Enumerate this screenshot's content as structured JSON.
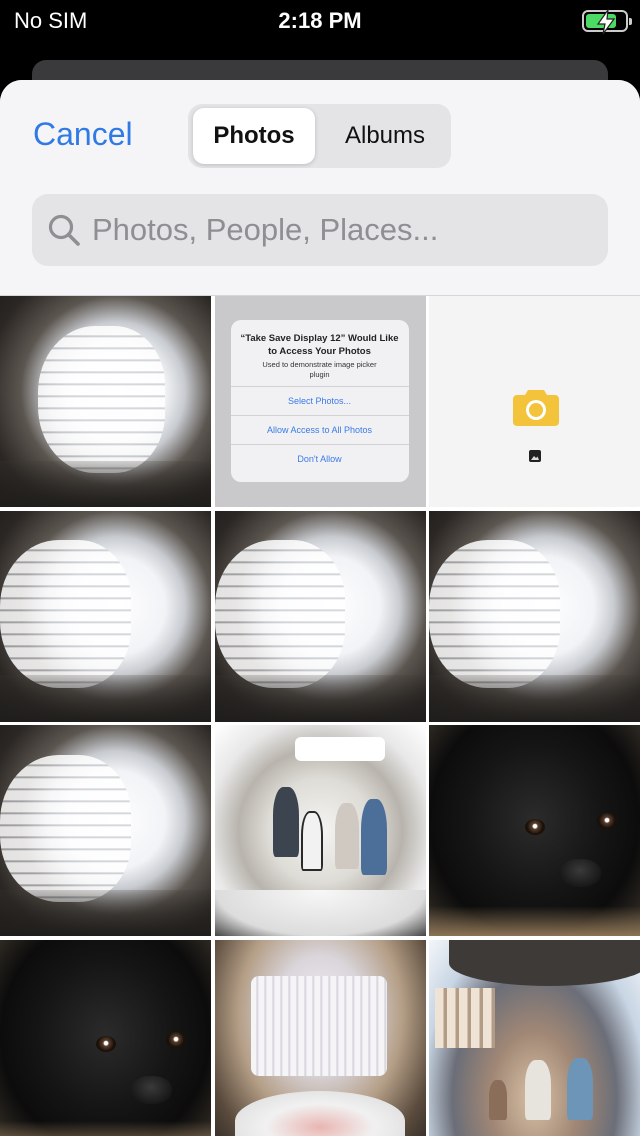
{
  "status_bar": {
    "carrier": "No SIM",
    "time": "2:18 PM",
    "battery_level": 0.7,
    "charging": true
  },
  "header": {
    "cancel_label": "Cancel",
    "segments": [
      {
        "label": "Photos",
        "selected": true
      },
      {
        "label": "Albums",
        "selected": false
      }
    ],
    "search": {
      "placeholder": "Photos, People, Places...",
      "value": ""
    }
  },
  "permission_dialog_thumbnail": {
    "title": "“Take Save Display 12” Would Like to Access Your Photos",
    "message": "Used to demonstrate image picker plugin",
    "buttons": [
      "Select Photos...",
      "Allow Access to All Photos",
      "Don't Allow"
    ]
  },
  "grid": {
    "columns": 3,
    "thumbnails": [
      "room-panorama",
      "permission-dialog-screenshot",
      "camera-placeholder",
      "room-panorama",
      "room-panorama",
      "room-panorama",
      "room-panorama",
      "office-group-panorama",
      "black-puppy",
      "black-puppy",
      "room-window-panorama",
      "outdoor-plaza-panorama"
    ]
  },
  "colors": {
    "accent": "#2f7ae5",
    "camera_icon": "#f3c33c",
    "battery": "#4cd964"
  }
}
